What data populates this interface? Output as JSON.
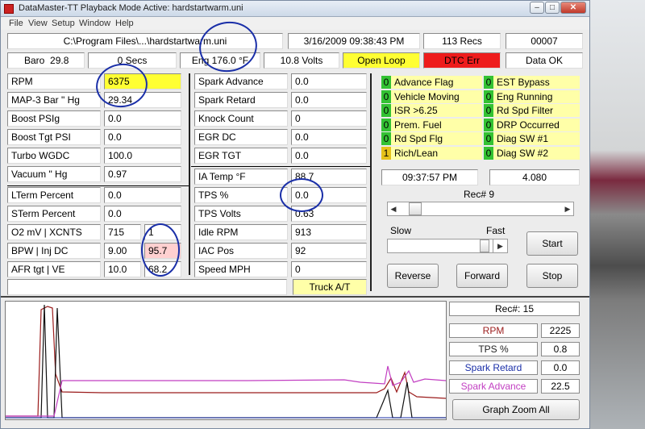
{
  "window": {
    "title": "DataMaster-TT  Playback Mode Active: hardstartwarm.uni"
  },
  "menu": [
    "File",
    "View",
    "Setup",
    "Window",
    "Help"
  ],
  "header": {
    "path": "C:\\Program Files\\...\\hardstartwarm.uni",
    "datetime": "3/16/2009  09:38:43 PM",
    "recs": "113 Recs",
    "counter": "00007",
    "baro_label": "Baro",
    "baro_value": "29.8",
    "secs": "0 Secs",
    "eng": "Eng 176.0 °F",
    "volts": "10.8 Volts",
    "loop": "Open Loop",
    "dtc": "DTC Err",
    "data_ok": "Data OK"
  },
  "left_params": [
    {
      "label": "RPM",
      "value": "6375"
    },
    {
      "label": "MAP-3 Bar  \" Hg",
      "value": "29.34"
    },
    {
      "label": "Boost PSIg",
      "value": "0.0"
    },
    {
      "label": "Boost Tgt PSI",
      "value": "0.0"
    },
    {
      "label": "Turbo WGDC",
      "value": "100.0"
    },
    {
      "label": "Vacuum  \" Hg",
      "value": "0.97"
    },
    {
      "label": "LTerm Percent",
      "value": "0.0"
    },
    {
      "label": "STerm Percent",
      "value": "0.0"
    },
    {
      "label": "O2 mV  |  XCNTS",
      "value": "715",
      "value2": "1"
    },
    {
      "label": "BPW   |  Inj DC",
      "value": "9.00",
      "value2": "95.7"
    },
    {
      "label": "AFR tgt  |  VE",
      "value": "10.0",
      "value2": "68.2"
    }
  ],
  "mid_params": [
    {
      "label": "Spark Advance",
      "value": "0.0"
    },
    {
      "label": "Spark Retard",
      "value": "0.0"
    },
    {
      "label": "Knock Count",
      "value": "0"
    },
    {
      "label": "EGR DC",
      "value": "0.0"
    },
    {
      "label": "EGR TGT",
      "value": "0.0"
    },
    {
      "label": "IA Temp °F",
      "value": "88.7"
    },
    {
      "label": "TPS %",
      "value": "0.0"
    },
    {
      "label": "TPS Volts",
      "value": "0.63"
    },
    {
      "label": "Idle RPM",
      "value": "913"
    },
    {
      "label": "IAC Pos",
      "value": "92"
    },
    {
      "label": "Speed MPH",
      "value": "0"
    }
  ],
  "truck": "Truck A/T",
  "flags_left": [
    {
      "value": "0",
      "label": "Advance Flag"
    },
    {
      "value": "0",
      "label": "Vehicle Moving"
    },
    {
      "value": "0",
      "label": "ISR >6.25"
    },
    {
      "value": "0",
      "label": "Prem. Fuel"
    },
    {
      "value": "0",
      "label": "Rd Spd Flg"
    },
    {
      "value": "1",
      "label": "Rich/Lean"
    }
  ],
  "flags_right": [
    {
      "value": "0",
      "label": "EST Bypass"
    },
    {
      "value": "0",
      "label": "Eng Running"
    },
    {
      "value": "0",
      "label": "Rd Spd Filter"
    },
    {
      "value": "0",
      "label": "DRP Occurred"
    },
    {
      "value": "0",
      "label": "Diag SW #1"
    },
    {
      "value": "0",
      "label": "Diag SW #2"
    }
  ],
  "playback": {
    "time": "09:37:57 PM",
    "elapsed": "4.080",
    "rec": "Rec# 9",
    "slow": "Slow",
    "fast": "Fast",
    "start": "Start",
    "reverse": "Reverse",
    "forward": "Forward",
    "stop": "Stop"
  },
  "graph_legend": {
    "rec": "Rec#:  15",
    "items": [
      {
        "label": "RPM",
        "value": "2225",
        "color": "#9b1c1c"
      },
      {
        "label": "TPS %",
        "value": "0.8",
        "color": "#222222"
      },
      {
        "label": "Spark Retard",
        "value": "0.0",
        "color": "#1a2fa8"
      },
      {
        "label": "Spark Advance",
        "value": "22.5",
        "color": "#c23fc2"
      }
    ],
    "zoom": "Graph Zoom All"
  }
}
